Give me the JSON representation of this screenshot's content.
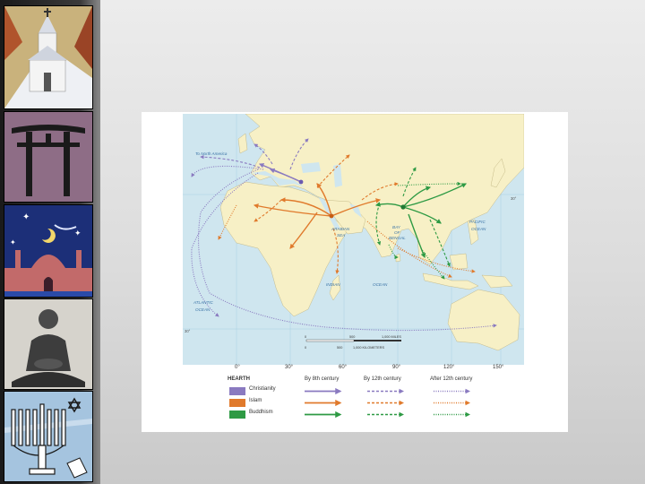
{
  "map": {
    "labels": {
      "north_america": "To North America",
      "pacific": "PACIFIC",
      "pacific2": "OCEAN",
      "arabian": "ARABIAN",
      "arabian2": "SEA",
      "bay": "BAY",
      "bay2": "OF",
      "bay3": "BENGAL",
      "indian": "INDIAN",
      "indian2": "OCEAN",
      "atlantic": "ATLANTIC",
      "atlantic2": "OCEAN"
    },
    "lat_ticks": [
      "30°",
      "30°"
    ],
    "lon_ticks": [
      "0°",
      "30°",
      "60°",
      "90°",
      "120°",
      "150°"
    ],
    "scale": {
      "miles_ticks": [
        "0",
        "500",
        "1,000 MILES"
      ],
      "km_ticks": [
        "0",
        "500",
        "1,000 KILOMETERS"
      ]
    }
  },
  "legend": {
    "hearth_header": "HEARTH",
    "col1": "By 8th century",
    "col2": "By 12th century",
    "col3": "After 12th century",
    "religions": [
      {
        "name": "Christianity",
        "color": "#8a7ac0"
      },
      {
        "name": "Islam",
        "color": "#e07a2c"
      },
      {
        "name": "Buddhism",
        "color": "#2e9a44"
      }
    ]
  },
  "colors": {
    "ocean": "#cfe6ef",
    "land": "#f7f0c6",
    "christianity": "#8a7ac0",
    "islam": "#e07a2c",
    "buddhism": "#2e9a44"
  },
  "sidebar_icons": [
    "church-icon",
    "torii-icon",
    "mosque-icon",
    "buddha-icon",
    "menorah-icon"
  ]
}
